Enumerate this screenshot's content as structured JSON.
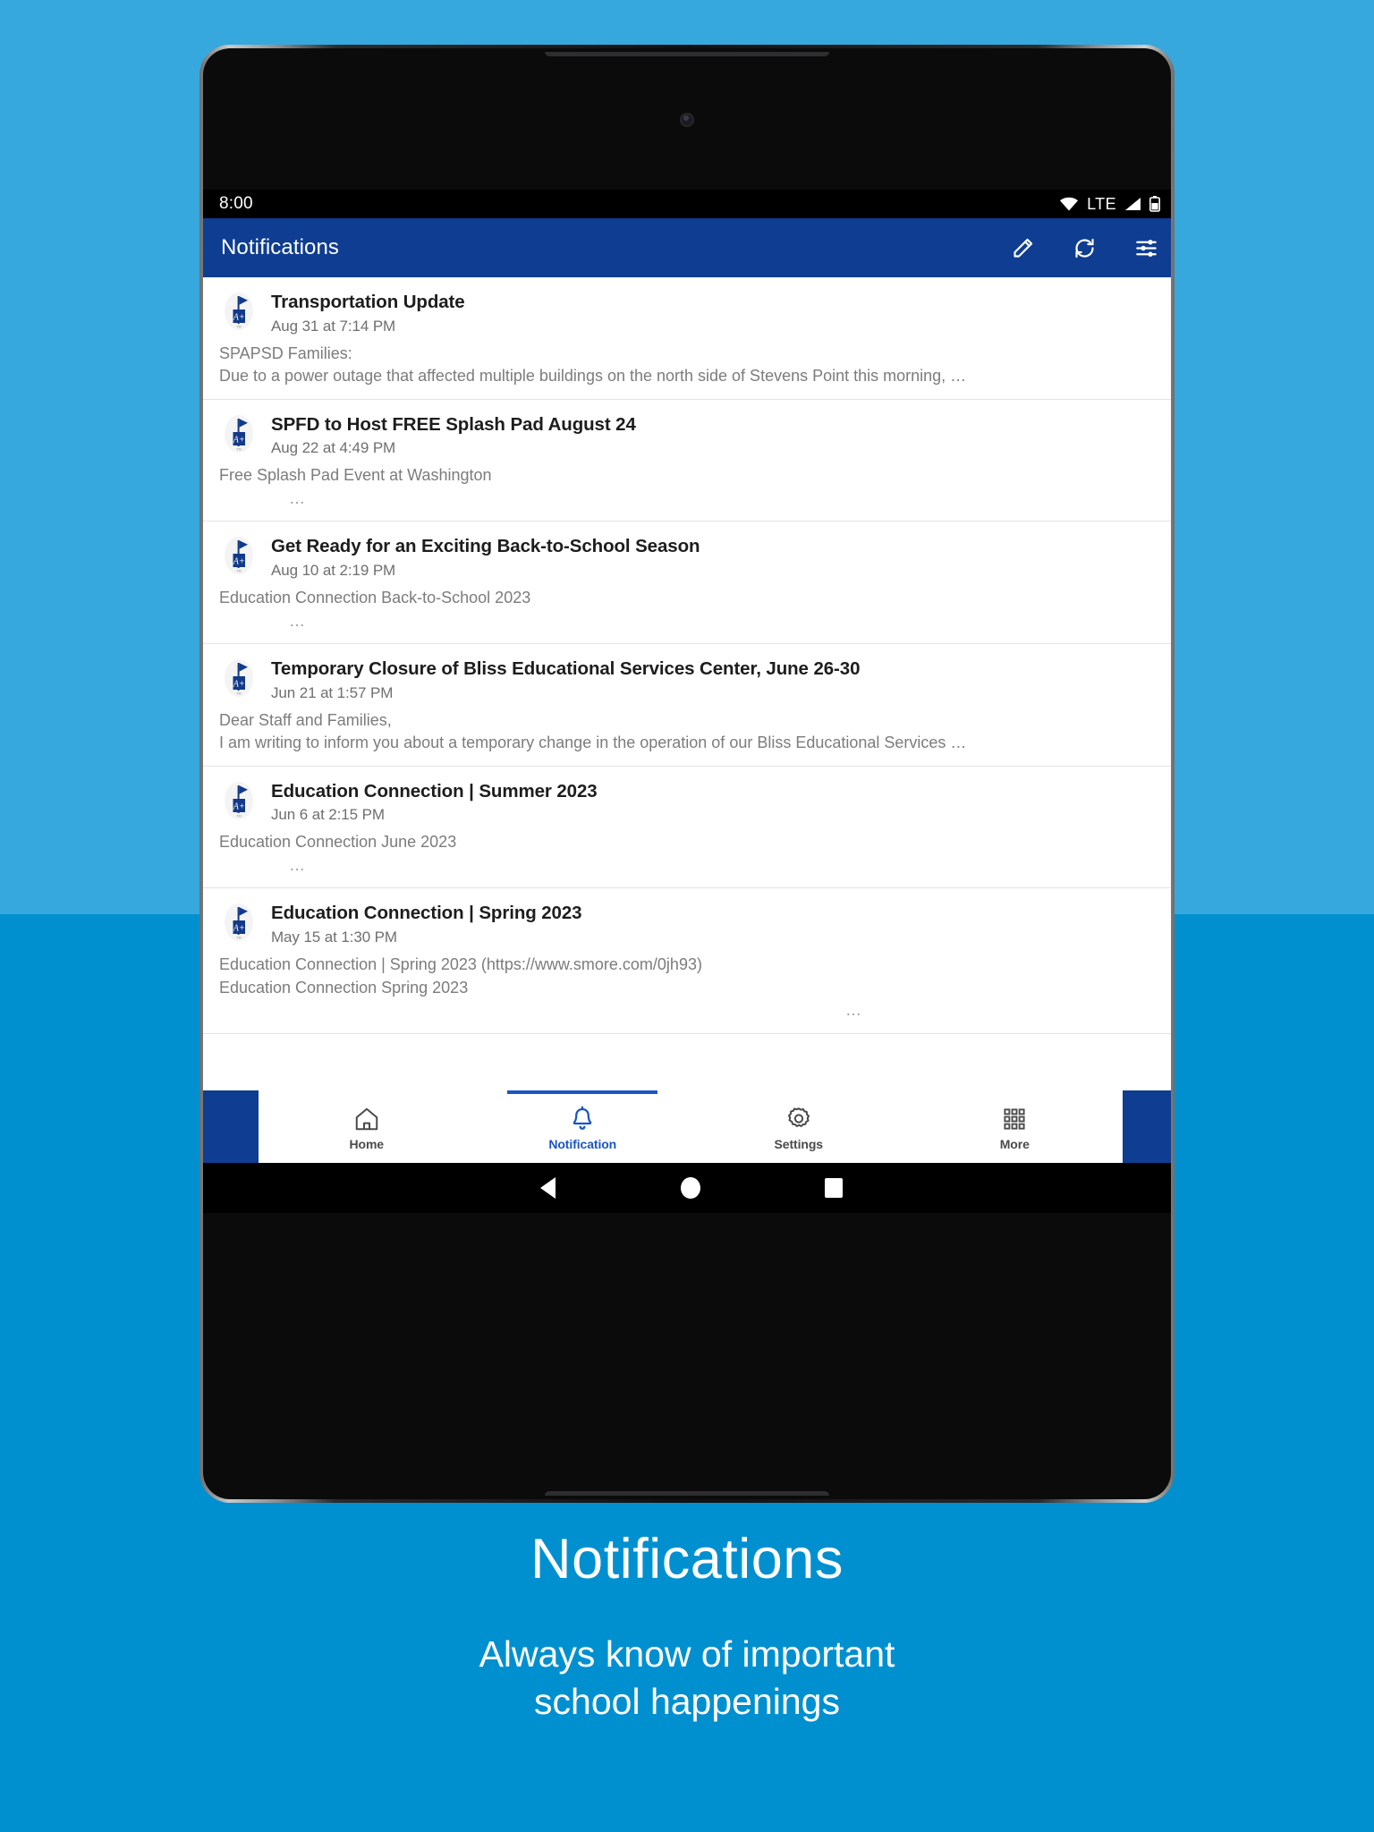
{
  "background": {
    "top_color": "#36a8dd",
    "bottom_color": "#0090d0"
  },
  "statusbar": {
    "time": "8:00",
    "network_label": "LTE",
    "icons": [
      "wifi-icon",
      "signal-icon",
      "battery-icon"
    ]
  },
  "appbar": {
    "title": "Notifications",
    "brand_color": "#0f3d91",
    "actions": [
      {
        "name": "compose-icon",
        "label": "Compose"
      },
      {
        "name": "refresh-icon",
        "label": "Refresh"
      },
      {
        "name": "filter-icon",
        "label": "Filter"
      }
    ]
  },
  "notifications": [
    {
      "title": "Transportation Update",
      "date": "Aug 31 at 7:14 PM",
      "lines": [
        "SPAPSD Families:",
        "Due to a power outage that affected multiple buildings on the north side of Stevens Point this morning, …"
      ],
      "ellipsis": "",
      "ellipsis_position": "none"
    },
    {
      "title": "SPFD to Host FREE Splash Pad August 24",
      "date": "Aug 22 at 4:49 PM",
      "lines": [
        "Free Splash Pad Event at Washington"
      ],
      "ellipsis": "…",
      "ellipsis_position": "indent"
    },
    {
      "title": "Get Ready for an Exciting Back-to-School Season",
      "date": "Aug 10 at 2:19 PM",
      "lines": [
        "Education Connection Back-to-School 2023"
      ],
      "ellipsis": "…",
      "ellipsis_position": "indent"
    },
    {
      "title": "Temporary Closure of Bliss Educational Services Center, June 26-30",
      "date": "Jun 21 at 1:57 PM",
      "lines": [
        "Dear Staff and Families,",
        "I am writing to inform you about a temporary change in the operation of our Bliss Educational Services …"
      ],
      "ellipsis": "",
      "ellipsis_position": "none"
    },
    {
      "title": "Education Connection | Summer 2023",
      "date": "Jun 6 at 2:15 PM",
      "lines": [
        "Education Connection June 2023"
      ],
      "ellipsis": "…",
      "ellipsis_position": "indent"
    },
    {
      "title": "Education Connection | Spring 2023",
      "date": "May 15 at 1:30 PM",
      "lines": [
        "Education Connection | Spring 2023 (https://www.smore.com/0jh93)",
        "Education Connection Spring 2023"
      ],
      "ellipsis": "…",
      "ellipsis_position": "right"
    }
  ],
  "bottomnav": {
    "active_color": "#1a56c4",
    "items": [
      {
        "label": "Home",
        "icon": "home-icon",
        "active": false
      },
      {
        "label": "Notification",
        "icon": "bell-icon",
        "active": true
      },
      {
        "label": "Settings",
        "icon": "gear-icon",
        "active": false
      },
      {
        "label": "More",
        "icon": "grid-icon",
        "active": false
      }
    ]
  },
  "sysnav": {
    "buttons": [
      "back-icon",
      "home-icon",
      "recents-icon"
    ]
  },
  "caption": {
    "title": "Notifications",
    "subtitle_line1": "Always know of important",
    "subtitle_line2": "school happenings"
  }
}
